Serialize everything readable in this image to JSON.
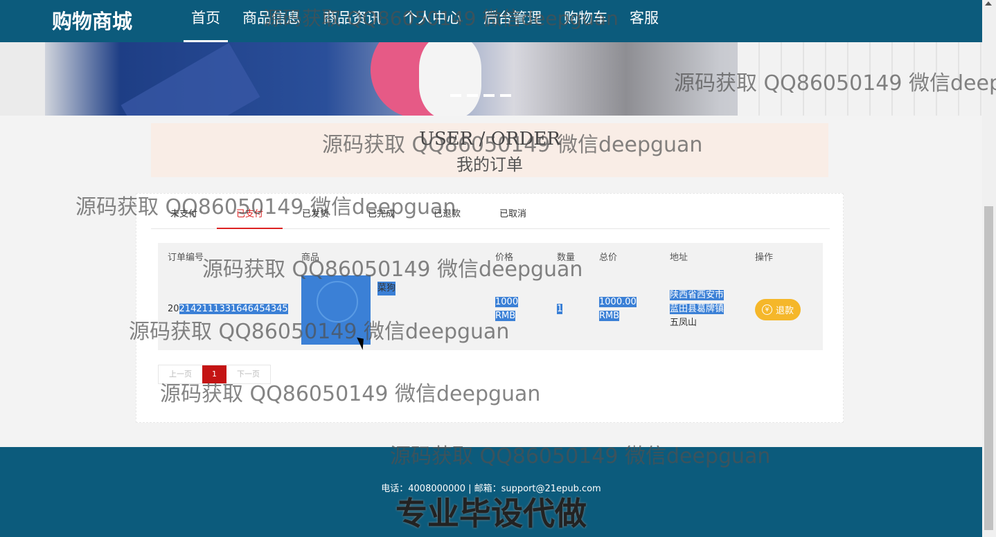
{
  "header": {
    "logo": "购物商城",
    "nav": [
      {
        "label": "首页",
        "active": true
      },
      {
        "label": "商品信息"
      },
      {
        "label": "商品资讯"
      },
      {
        "label": "个人中心"
      },
      {
        "label": "后台管理"
      },
      {
        "label": "购物车"
      },
      {
        "label": "客服"
      }
    ]
  },
  "section_title": {
    "en": "USER / ORDER",
    "cn": "我的订单"
  },
  "tabs": [
    "未支付",
    "已支付",
    "已发货",
    "已完成",
    "已退款",
    "已取消"
  ],
  "table": {
    "headers": {
      "order_no": "订单编号",
      "product": "商品",
      "price": "价格",
      "qty": "数量",
      "total": "总价",
      "address": "地址",
      "action": "操作"
    },
    "row": {
      "order_no_prefix": "20",
      "order_no_rest": "2142111331646454345",
      "product_name": "菜狗",
      "price_line1": "1000",
      "price_line2": "RMB",
      "qty": "1",
      "total_line1": "1000.00",
      "total_line2": "RMB",
      "address_line1": "陕西省西安市",
      "address_line2": "蓝田县葛牌镇",
      "address_line3": "五凤山",
      "action_label": "退款",
      "action_icon": "¥"
    }
  },
  "pager": {
    "prev": "上一页",
    "current": "1",
    "next": "下一页"
  },
  "footer": {
    "contact": "电话：4008000000 | 邮箱：support@21epub.com",
    "slogan": "专业毕设代做"
  },
  "watermark": "源码获取 QQ86050149 微信deepguan",
  "colors": {
    "header_bg": "#0c5b7c",
    "accent_red": "#d22222",
    "refund_btn": "#f5b72a",
    "selection": "#3b80d6"
  }
}
